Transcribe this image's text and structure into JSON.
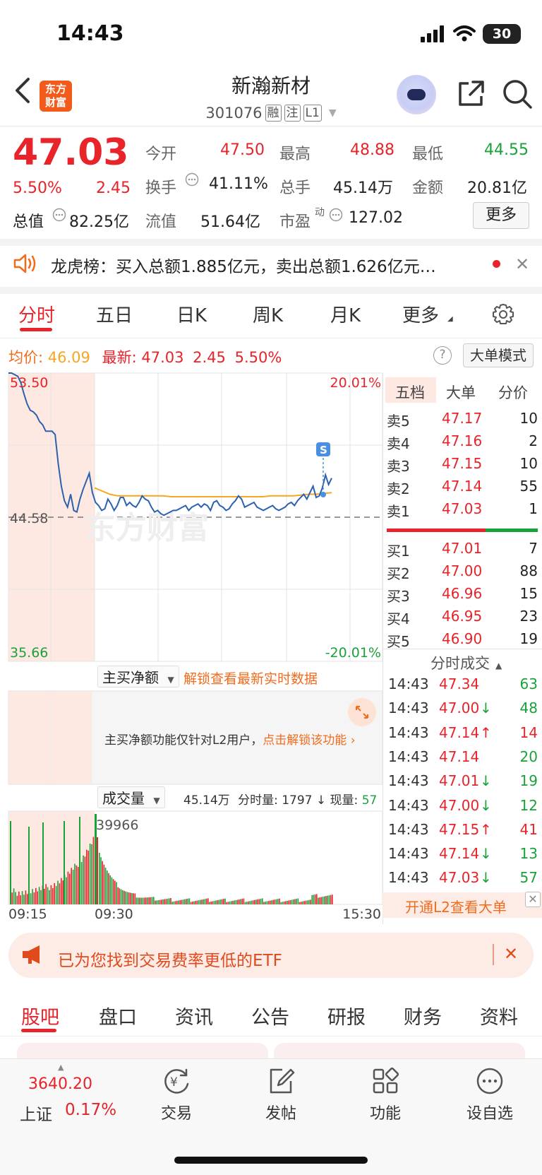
{
  "status_bar": {
    "time": "14:43",
    "battery": "30"
  },
  "header": {
    "logo_line1": "东方",
    "logo_line2": "财富",
    "stock_name": "新瀚新材",
    "stock_code": "301076",
    "tags": [
      "融",
      "注",
      "L1"
    ]
  },
  "quote": {
    "price": "47.03",
    "change_pct": "5.50%",
    "change": "2.45",
    "open_label": "今开",
    "open": "47.50",
    "high_label": "最高",
    "high": "48.88",
    "low_label": "最低",
    "low": "44.55",
    "turnover_label": "换手",
    "turnover": "41.11%",
    "volume_label": "总手",
    "volume": "45.14万",
    "amount_label": "金额",
    "amount": "20.81亿",
    "mktcap_label": "总值",
    "mktcap": "82.25亿",
    "float_label": "流值",
    "float": "51.64亿",
    "pe_label": "市盈",
    "pe_sup": "动",
    "pe": "127.02",
    "more": "更多"
  },
  "notice": {
    "text": "龙虎榜：买入总额1.885亿元，卖出总额1.626亿元…"
  },
  "chart_tabs": [
    "分时",
    "五日",
    "日K",
    "周K",
    "月K",
    "更多"
  ],
  "info_line": {
    "avg_label": "均价:",
    "avg": "46.09",
    "latest_label": "最新:",
    "latest": "47.03",
    "change": "2.45",
    "change_pct": "5.50%",
    "help": "?",
    "big_order_mode": "大单模式"
  },
  "chart_data": {
    "type": "line",
    "title": "",
    "y_top": "53.50",
    "y_mid": "44.58",
    "y_bottom": "35.66",
    "pct_top": "20.01%",
    "pct_bottom": "-20.01%",
    "x_labels": [
      "09:15",
      "09:30",
      "15:30"
    ],
    "volume_peak_label": "39966",
    "series": [
      {
        "values": [
          53.5,
          53.5,
          53.4,
          53.3,
          52.9,
          52.2,
          51.6,
          51.2,
          51.1,
          50.9,
          50.5,
          50.3,
          49.9,
          49.9,
          49.9,
          49.7,
          47.9,
          46.5,
          45.6,
          45.2,
          46.0,
          45.0,
          44.9,
          45.7,
          46.3,
          46.8,
          47.3,
          46.1,
          45.5,
          45.3,
          45.0,
          45.1,
          45.7,
          45.4,
          45.0,
          45.3,
          45.8,
          45.8,
          45.3,
          45.5,
          45.3,
          45.2,
          45.5,
          45.9,
          45.7,
          45.6,
          45.2,
          44.9,
          45.0,
          44.8,
          44.7,
          44.8,
          44.9,
          45.0,
          45.0,
          45.1,
          45.2,
          45.3,
          45.0,
          45.2,
          45.3,
          45.4,
          45.2,
          45.4,
          45.3,
          45.0,
          45.5,
          45.6,
          45.3,
          45.2,
          45.0,
          45.1,
          45.4,
          45.6,
          45.9,
          45.7,
          45.2,
          45.3,
          45.4,
          45.5,
          45.2,
          45.1,
          45.0,
          45.1,
          45.2,
          45.3,
          45.1,
          45.0,
          45.1,
          45.2,
          45.4,
          45.5,
          45.3,
          45.6,
          45.8,
          46.0,
          45.7,
          46.1,
          46.5,
          45.8,
          45.9,
          46.4,
          47.2,
          46.6,
          47.0
        ]
      },
      {
        "values": [
          46.4,
          46.2,
          46.0,
          45.9,
          45.9,
          45.9,
          45.9,
          45.9,
          45.9,
          45.9,
          45.85,
          45.85,
          45.85,
          45.85,
          45.85,
          45.85,
          45.85,
          45.85,
          45.85,
          45.85,
          45.85,
          45.85,
          45.85,
          45.9,
          45.9,
          45.9,
          45.9,
          45.95,
          46.0,
          46.0,
          46.05,
          46.1
        ]
      }
    ]
  },
  "main_buy": {
    "label": "主买净额",
    "unlock": "解锁查看最新实时数据",
    "info": "主买净额功能仅针对L2用户，",
    "info_link": "点击解锁该功能"
  },
  "volume_panel": {
    "label": "成交量",
    "total": "45.14万",
    "minute_label": "分时量:",
    "minute": "1797",
    "current_label": "现量:",
    "current": "57"
  },
  "order_book": {
    "tabs": [
      "五档",
      "大单",
      "分价"
    ],
    "asks": [
      {
        "label": "卖5",
        "price": "47.17",
        "vol": "10"
      },
      {
        "label": "卖4",
        "price": "47.16",
        "vol": "2"
      },
      {
        "label": "卖3",
        "price": "47.15",
        "vol": "10"
      },
      {
        "label": "卖2",
        "price": "47.14",
        "vol": "55"
      },
      {
        "label": "卖1",
        "price": "47.03",
        "vol": "1"
      }
    ],
    "bids": [
      {
        "label": "买1",
        "price": "47.01",
        "vol": "7"
      },
      {
        "label": "买2",
        "price": "47.00",
        "vol": "88"
      },
      {
        "label": "买3",
        "price": "46.96",
        "vol": "15"
      },
      {
        "label": "买4",
        "price": "46.95",
        "vol": "23"
      },
      {
        "label": "买5",
        "price": "46.90",
        "vol": "19"
      }
    ]
  },
  "ticks": {
    "header": "分时成交",
    "rows": [
      {
        "time": "14:43",
        "price": "47.34",
        "arrow": "",
        "vol": "63",
        "dir": "green"
      },
      {
        "time": "14:43",
        "price": "47.00",
        "arrow": "↓",
        "vol": "48",
        "dir": "green"
      },
      {
        "time": "14:43",
        "price": "47.14",
        "arrow": "↑",
        "vol": "14",
        "dir": "red"
      },
      {
        "time": "14:43",
        "price": "47.14",
        "arrow": "",
        "vol": "20",
        "dir": "green"
      },
      {
        "time": "14:43",
        "price": "47.01",
        "arrow": "↓",
        "vol": "19",
        "dir": "green"
      },
      {
        "time": "14:43",
        "price": "47.00",
        "arrow": "↓",
        "vol": "12",
        "dir": "green"
      },
      {
        "time": "14:43",
        "price": "47.15",
        "arrow": "↑",
        "vol": "41",
        "dir": "red"
      },
      {
        "time": "14:43",
        "price": "47.14",
        "arrow": "↓",
        "vol": "13",
        "dir": "green"
      },
      {
        "time": "14:43",
        "price": "47.03",
        "arrow": "↓",
        "vol": "57",
        "dir": "green"
      }
    ],
    "l2_cta": "开通L2查看大单"
  },
  "etf_banner": {
    "text": "已为您找到交易费率更低的ETF"
  },
  "bottom_tabs": [
    "股吧",
    "盘口",
    "资讯",
    "公告",
    "研报",
    "财务",
    "资料"
  ],
  "bottom_nav": {
    "index_value": "3640.20",
    "index_name": "上证",
    "index_pct": "0.17%",
    "items": [
      "交易",
      "发帖",
      "功能",
      "设自选"
    ]
  },
  "colors": {
    "up": "#e8232a",
    "down": "#1aa23a",
    "accent": "#f26b1d",
    "price_line": "#2a62b0",
    "avg_line": "#f5a623"
  }
}
